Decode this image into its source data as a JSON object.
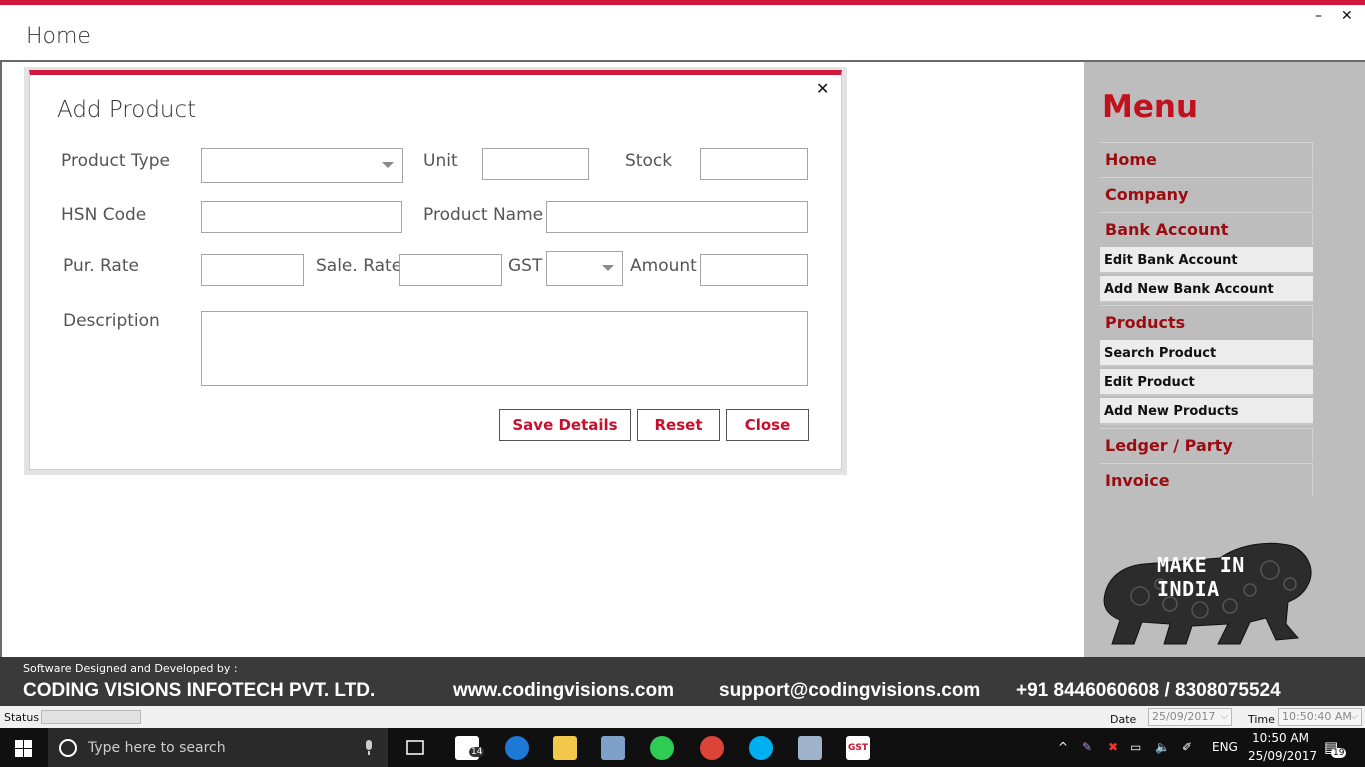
{
  "window": {
    "title": "Home",
    "minimize_glyph": "–",
    "close_glyph": "✕"
  },
  "dialog": {
    "title": "Add Product",
    "close_glyph": "✕",
    "labels": {
      "product_type": "Product Type",
      "unit": "Unit",
      "stock": "Stock",
      "hsn_code": "HSN Code",
      "product_name": "Product Name",
      "pur_rate": "Pur. Rate",
      "sale_rate": "Sale. Rate",
      "gst": "GST",
      "amount": "Amount",
      "description": "Description"
    },
    "values": {
      "product_type": "",
      "unit": "",
      "stock": "",
      "hsn_code": "",
      "product_name": "",
      "pur_rate": "",
      "sale_rate": "",
      "gst": "",
      "amount": "",
      "description": ""
    },
    "buttons": {
      "save": "Save Details",
      "reset": "Reset",
      "close": "Close"
    }
  },
  "menu": {
    "title": "Menu",
    "items": [
      {
        "label": "Home",
        "level": "main"
      },
      {
        "label": "Company",
        "level": "main"
      },
      {
        "label": "Bank Account",
        "level": "main"
      },
      {
        "label": "Edit Bank Account",
        "level": "sub"
      },
      {
        "label": "Add New Bank Account",
        "level": "sub"
      },
      {
        "label": "Products",
        "level": "main"
      },
      {
        "label": "Search Product",
        "level": "sub"
      },
      {
        "label": "Edit Product",
        "level": "sub"
      },
      {
        "label": "Add New Products",
        "level": "sub"
      },
      {
        "label": "Ledger / Party",
        "level": "main"
      },
      {
        "label": "Invoice",
        "level": "main"
      }
    ],
    "logo_text": "MAKE IN INDIA"
  },
  "footer": {
    "credit": "Software Designed and Developed by :",
    "company": "CODING VISIONS INFOTECH PVT. LTD.",
    "website": "www.codingvisions.com",
    "email": "support@codingvisions.com",
    "phone": "+91 8446060608 / 8308075524"
  },
  "statusbar": {
    "status_label": "Status",
    "date_label": "Date",
    "date_value": "25/09/2017",
    "time_label": "Time",
    "time_value": "10:50:40 AM"
  },
  "taskbar": {
    "search_placeholder": "Type here to search",
    "mail_badge": "14",
    "language": "ENG",
    "time": "10:50 AM",
    "date": "25/09/2017",
    "notification_count": "19",
    "gst_icon_label": "GST"
  },
  "colors": {
    "accent": "#d0183c",
    "menu_text": "#9b0c12",
    "button_text": "#c8102e",
    "menu_panel": "#bdbdbd",
    "footer_bg": "#3a3a3a"
  }
}
